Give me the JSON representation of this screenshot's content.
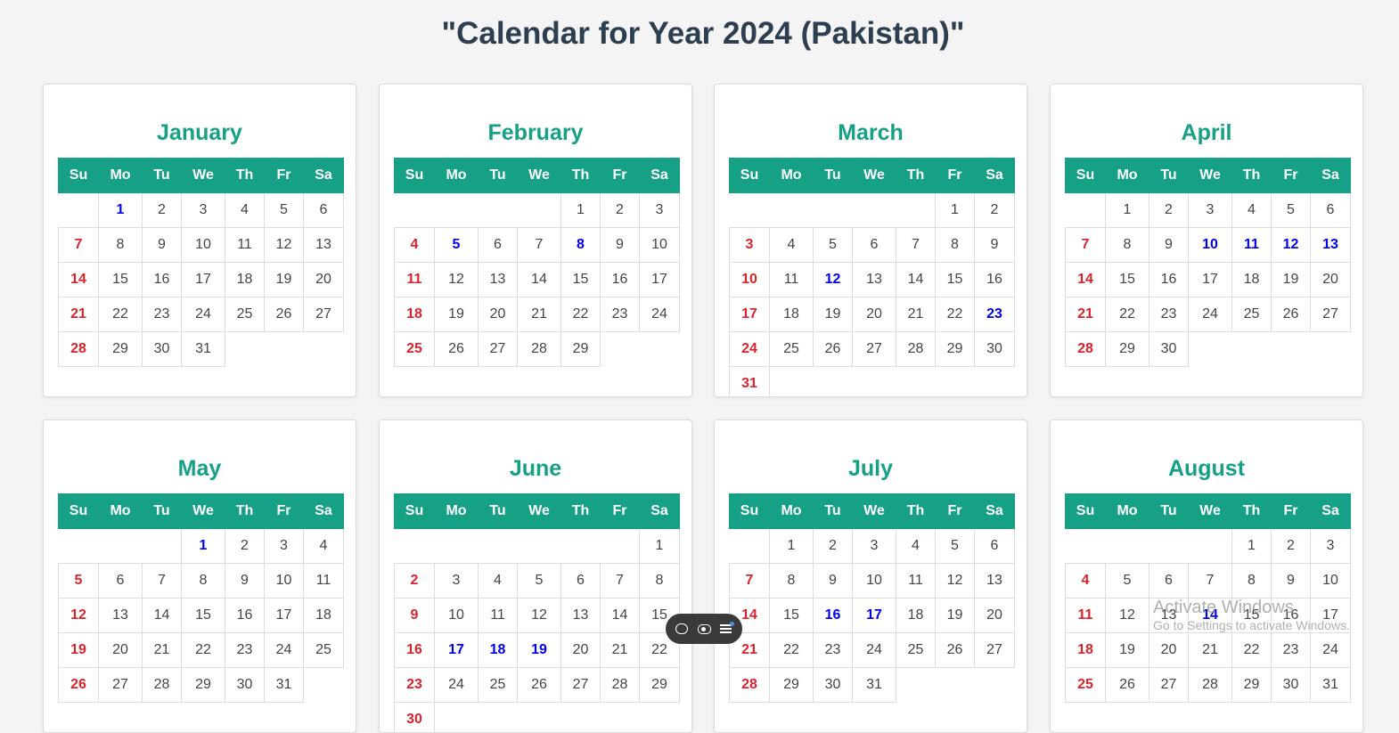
{
  "page": {
    "title": "\"Calendar for Year 2024 (Pakistan)\""
  },
  "weekdays": [
    "Su",
    "Mo",
    "Tu",
    "We",
    "Th",
    "Fr",
    "Sa"
  ],
  "colors": {
    "header": "#16a085",
    "sunday": "#d9232d",
    "holiday": "#0000ee",
    "title": "#2c3e50"
  },
  "months": [
    {
      "name": "January",
      "first_weekday": 1,
      "days": 31,
      "holidays": [
        1
      ]
    },
    {
      "name": "February",
      "first_weekday": 4,
      "days": 29,
      "holidays": [
        5,
        8
      ]
    },
    {
      "name": "March",
      "first_weekday": 5,
      "days": 31,
      "holidays": [
        12,
        23
      ]
    },
    {
      "name": "April",
      "first_weekday": 1,
      "days": 30,
      "holidays": [
        10,
        11,
        12,
        13
      ]
    },
    {
      "name": "May",
      "first_weekday": 3,
      "days": 31,
      "holidays": [
        1
      ]
    },
    {
      "name": "June",
      "first_weekday": 6,
      "days": 30,
      "holidays": [
        17,
        18,
        19
      ]
    },
    {
      "name": "July",
      "first_weekday": 1,
      "days": 31,
      "holidays": [
        16,
        17
      ]
    },
    {
      "name": "August",
      "first_weekday": 4,
      "days": 31,
      "holidays": [
        14
      ]
    }
  ],
  "widget": {
    "icons": [
      "chat-icon",
      "eye-icon",
      "menu-icon"
    ]
  },
  "watermark": {
    "line1": "Activate Windows",
    "line2": "Go to Settings to activate Windows."
  }
}
